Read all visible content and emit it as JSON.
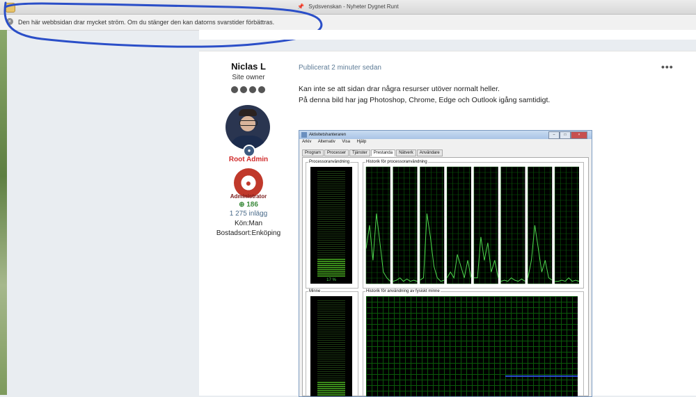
{
  "window": {
    "title": "Sydsvenskan - Nyheter Dygnet Runt",
    "title_icon": "pin-icon"
  },
  "warning_bar": {
    "message": "Den här webbsidan drar mycket ström. Om du stänger den kan datorns svarstider förbättras.",
    "close_icon": "close-icon",
    "annotation_color": "#2b4fc8"
  },
  "post": {
    "author": {
      "name": "Niclas L",
      "title": "Site owner",
      "rank_pips": 4,
      "group": "Root Admin",
      "badge_label": "Administrator",
      "reputation": "186",
      "posts": "1 275 inlägg",
      "gender": "Kön:Man",
      "location": "Bostadsort:Enköping",
      "group_color": "#d02c2c"
    },
    "published": "Publicerat 2 minuter sedan",
    "more_icon": "ellipsis-icon",
    "body": [
      "Kan inte se att sidan drar några resurser utöver normalt heller.",
      "På denna bild har jag Photoshop, Chrome, Edge och Outlook igång samtidigt."
    ],
    "screenshot": {
      "title": "Aktivitetshanteraren",
      "menu": [
        "Arkiv",
        "Alternativ",
        "Visa",
        "Hjälp"
      ],
      "tabs": [
        "Program",
        "Processer",
        "Tjänster",
        "Prestanda",
        "Nätverk",
        "Användare"
      ],
      "active_tab": "Prestanda",
      "cpu_label": "Processoranvändning",
      "cpu_history_label": "Historik för processoranvändning",
      "cpu_value": "17 %",
      "cpu_fraction": 0.17,
      "mem_label": "Minne",
      "mem_history_label": "Historik för användning av fysiskt minne",
      "mem_fraction": 0.15,
      "graph_color": "#4fd84f"
    }
  }
}
